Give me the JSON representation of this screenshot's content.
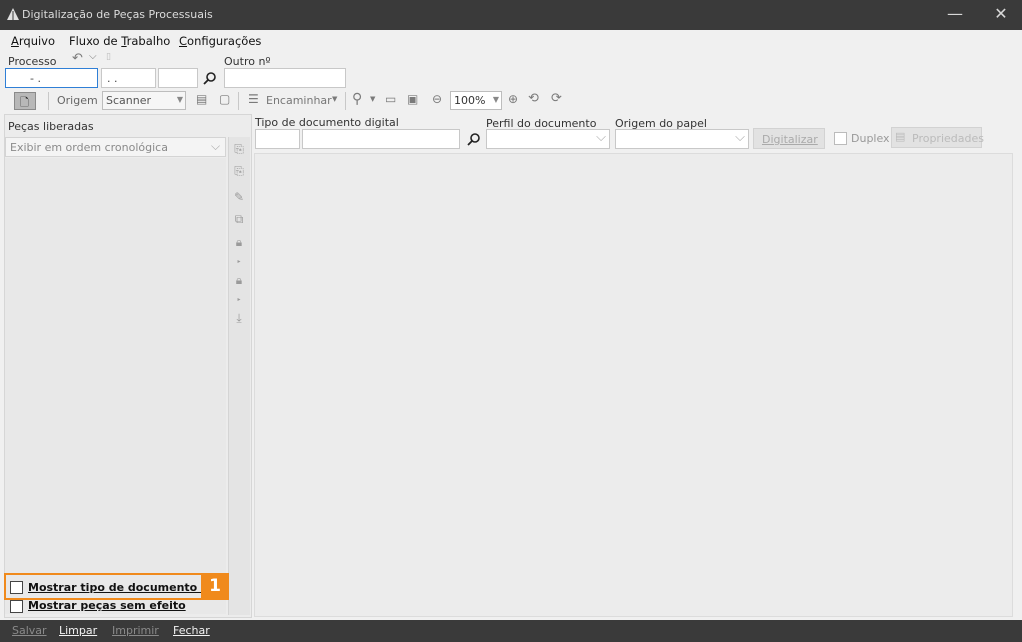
{
  "window": {
    "title": "Digitalização de Peças Processuais",
    "minimize": "—",
    "close": "✕"
  },
  "menu": {
    "arquivo": {
      "first": "A",
      "rest": "rquivo"
    },
    "fluxo": {
      "pre": "Fluxo de ",
      "under": "T",
      "post": "rabalho"
    },
    "config": {
      "first": "C",
      "rest": "onfigurações"
    }
  },
  "search": {
    "processo_label": "Processo",
    "outro_label": "Outro nº",
    "processo_part1": "- .",
    "processo_part2": ". .",
    "processo_part3": "",
    "outro_value": ""
  },
  "toolbar": {
    "origem_label": "Origem",
    "origem_value": "Scanner",
    "encaminhar_label": "Encaminhar",
    "zoom_value": "100%"
  },
  "left": {
    "title": "Peças liberadas",
    "order_value": "Exibir em ordem cronológica",
    "show_saj_label": "Mostrar tipo de documento SAJ",
    "show_sem_efeito_label": "Mostrar peças sem efeito",
    "show_saj_checked": false,
    "show_sem_efeito_checked": false
  },
  "doc": {
    "tipo_label": "Tipo de documento digital",
    "perfil_label": "Perfil do documento",
    "origem_papel_label": "Origem do papel",
    "digitalizar_label": "Digitalizar",
    "duplex_label": "Duplex",
    "propriedades_label": "Propriedades"
  },
  "bottom": {
    "salvar": "Salvar",
    "limpar": "Limpar",
    "imprimir": "Imprimir",
    "fechar": "Fechar"
  },
  "callout": {
    "number": "1",
    "color": "#f08a1c"
  }
}
